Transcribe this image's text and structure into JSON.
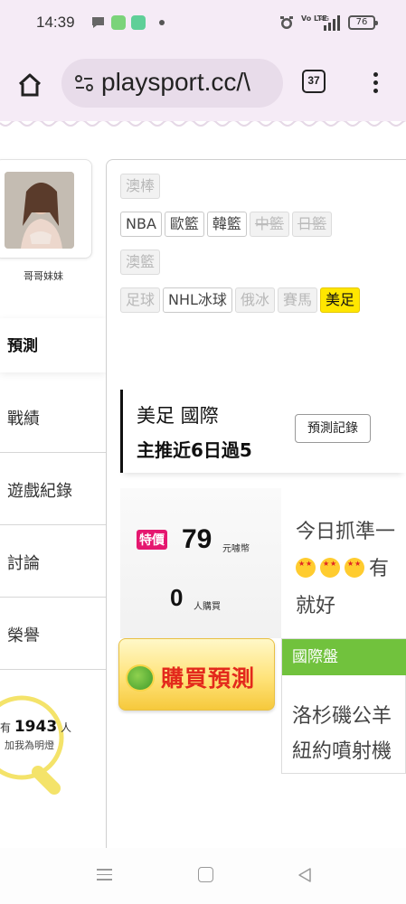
{
  "status_bar": {
    "time": "14:39",
    "network_label": "Vo LTE",
    "signal_label": "4G",
    "battery": "76"
  },
  "browser": {
    "url": "playsport.cc/\\",
    "tab_count": "37"
  },
  "sidebar": {
    "user_name": "哥哥妹妹",
    "active_tab": "預測",
    "items": [
      {
        "label": "戰績"
      },
      {
        "label": "遊戲紀錄"
      },
      {
        "label": "討論"
      },
      {
        "label": "榮譽"
      }
    ],
    "fans_prefix": "有",
    "fans_count": "1943",
    "fans_suffix": "人",
    "fans_note": "加我為明燈"
  },
  "categories": {
    "row1": [
      "澳棒"
    ],
    "row2": [
      "NBA",
      "歐籃",
      "韓籃",
      "中籃",
      "日籃"
    ],
    "row3": [
      "澳籃"
    ],
    "row4": [
      "足球",
      "NHL冰球",
      "俄冰",
      "賽馬",
      "美足"
    ]
  },
  "prediction": {
    "league": "美足 國際",
    "headline": "主推近6日過5",
    "record_button": "預測記錄",
    "sale_tag": "特價",
    "price": "79",
    "price_unit": "元噱幣",
    "buyers": "0",
    "buyers_unit": "人購買",
    "desc_line1": "今日抓準一",
    "desc_line2": "有",
    "desc_line3": "就好",
    "buy_button": "購買預測",
    "pick_market": "國際盤",
    "pick_line1": "洛杉磯公羊",
    "pick_line2": "紐約噴射機"
  },
  "colors": {
    "accent_green": "#71c23d",
    "sale_pink": "#e5176f",
    "buy_red": "#e3291c",
    "highlight_yellow": "#ffe600",
    "chrome_bg": "#f5ebf6"
  }
}
